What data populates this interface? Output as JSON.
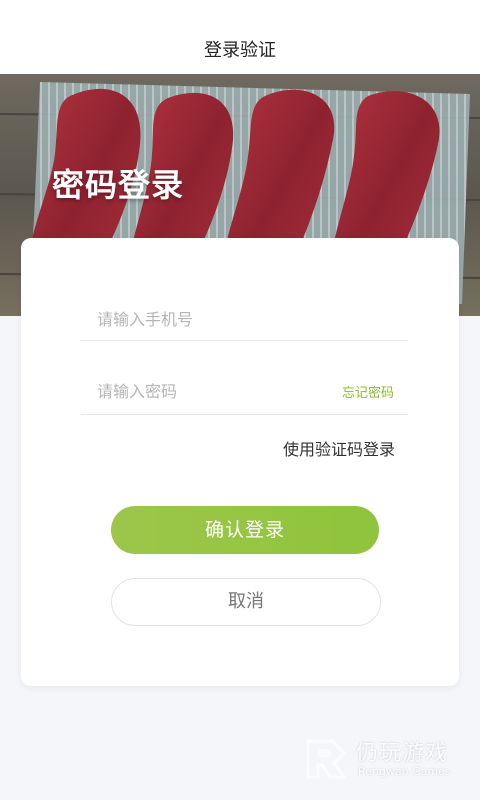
{
  "header": {
    "title": "登录验证"
  },
  "hero": {
    "title": "密码登录",
    "image_icon": "steak-photo"
  },
  "form": {
    "phone_placeholder": "请输入手机号",
    "phone_value": "",
    "password_placeholder": "请输入密码",
    "password_value": "",
    "forgot_password_label": "忘记密码",
    "sms_login_label": "使用验证码登录",
    "confirm_label": "确认登录",
    "cancel_label": "取消"
  },
  "colors": {
    "accent": "#8fc43c",
    "forgot_link": "#8cbb2c",
    "background": "#f5f6f9"
  },
  "watermark": {
    "brand_cn": "仍玩游戏",
    "brand_en": "Rengwan Games"
  }
}
